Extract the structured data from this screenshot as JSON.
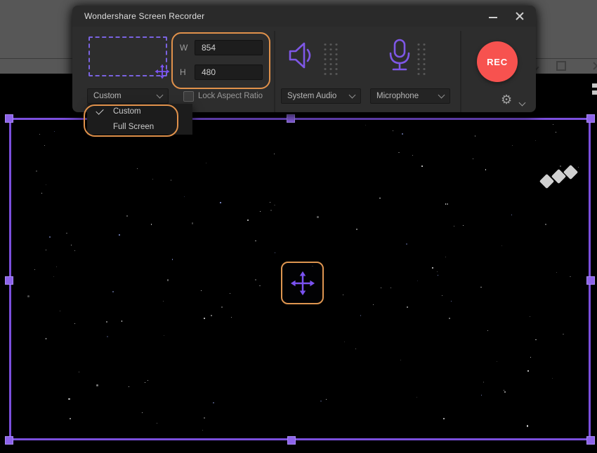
{
  "window": {
    "title": "Wondershare Screen Recorder"
  },
  "size_section": {
    "width_label": "W",
    "width_value": "854",
    "height_label": "H",
    "height_value": "480",
    "preset_value": "Custom",
    "lock_aspect_label": "Lock Aspect Ratio",
    "menu_items": [
      {
        "label": "Custom",
        "selected": true
      },
      {
        "label": "Full Screen",
        "selected": false
      }
    ]
  },
  "audio_section": {
    "device_value": "System Audio"
  },
  "mic_section": {
    "device_value": "Microphone"
  },
  "record_section": {
    "rec_label": "REC"
  },
  "icons": {
    "gear_glyph": "⚙"
  },
  "colors": {
    "accent_orange": "#e0914b",
    "accent_purple": "#7e57e6",
    "capture_border_purple": "#7b4fdd",
    "rec_red": "#f7524f",
    "panel_bg": "#2d2d2d"
  }
}
